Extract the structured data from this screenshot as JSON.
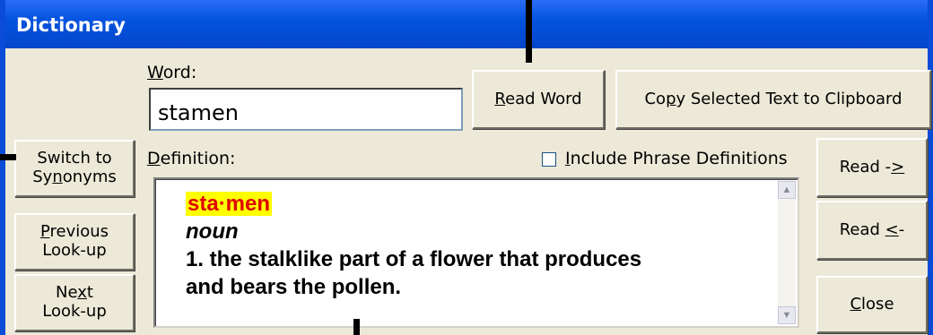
{
  "window": {
    "title": "Dictionary"
  },
  "word": {
    "label_prefix": "",
    "label_accel": "W",
    "label_rest": "ord:",
    "value": "stamen"
  },
  "buttons": {
    "read_word": {
      "accel": "R",
      "rest": "ead Word"
    },
    "copy": {
      "pre": "Co",
      "accel": "p",
      "rest": "y Selected Text to Clipboard"
    },
    "switch_synonyms": {
      "line1": "Switch to",
      "line2_pre": "Sy",
      "line2_accel": "n",
      "line2_rest": "onyms"
    },
    "previous": {
      "line1_accel": "P",
      "line1_rest": "revious",
      "line2": "Look-up"
    },
    "next": {
      "line1_pre": "Ne",
      "line1_accel": "x",
      "line1_rest": "t",
      "line2": "Look-up"
    },
    "read_forward": {
      "pre": "Read -",
      "accel": ">"
    },
    "read_back": {
      "pre": "Read ",
      "accel": "<",
      "rest": "-"
    },
    "close": {
      "accel": "C",
      "rest": "lose"
    }
  },
  "definition": {
    "label_accel": "D",
    "label_rest": "efinition:",
    "headword": "sta·men",
    "part_of_speech": "noun",
    "sense_line1": "1. the stalklike part of a flower that produces",
    "sense_line2": "and bears the pollen."
  },
  "phrase_checkbox": {
    "pre": "",
    "accel": "I",
    "rest": "nclude Phrase Definitions",
    "checked": false
  }
}
